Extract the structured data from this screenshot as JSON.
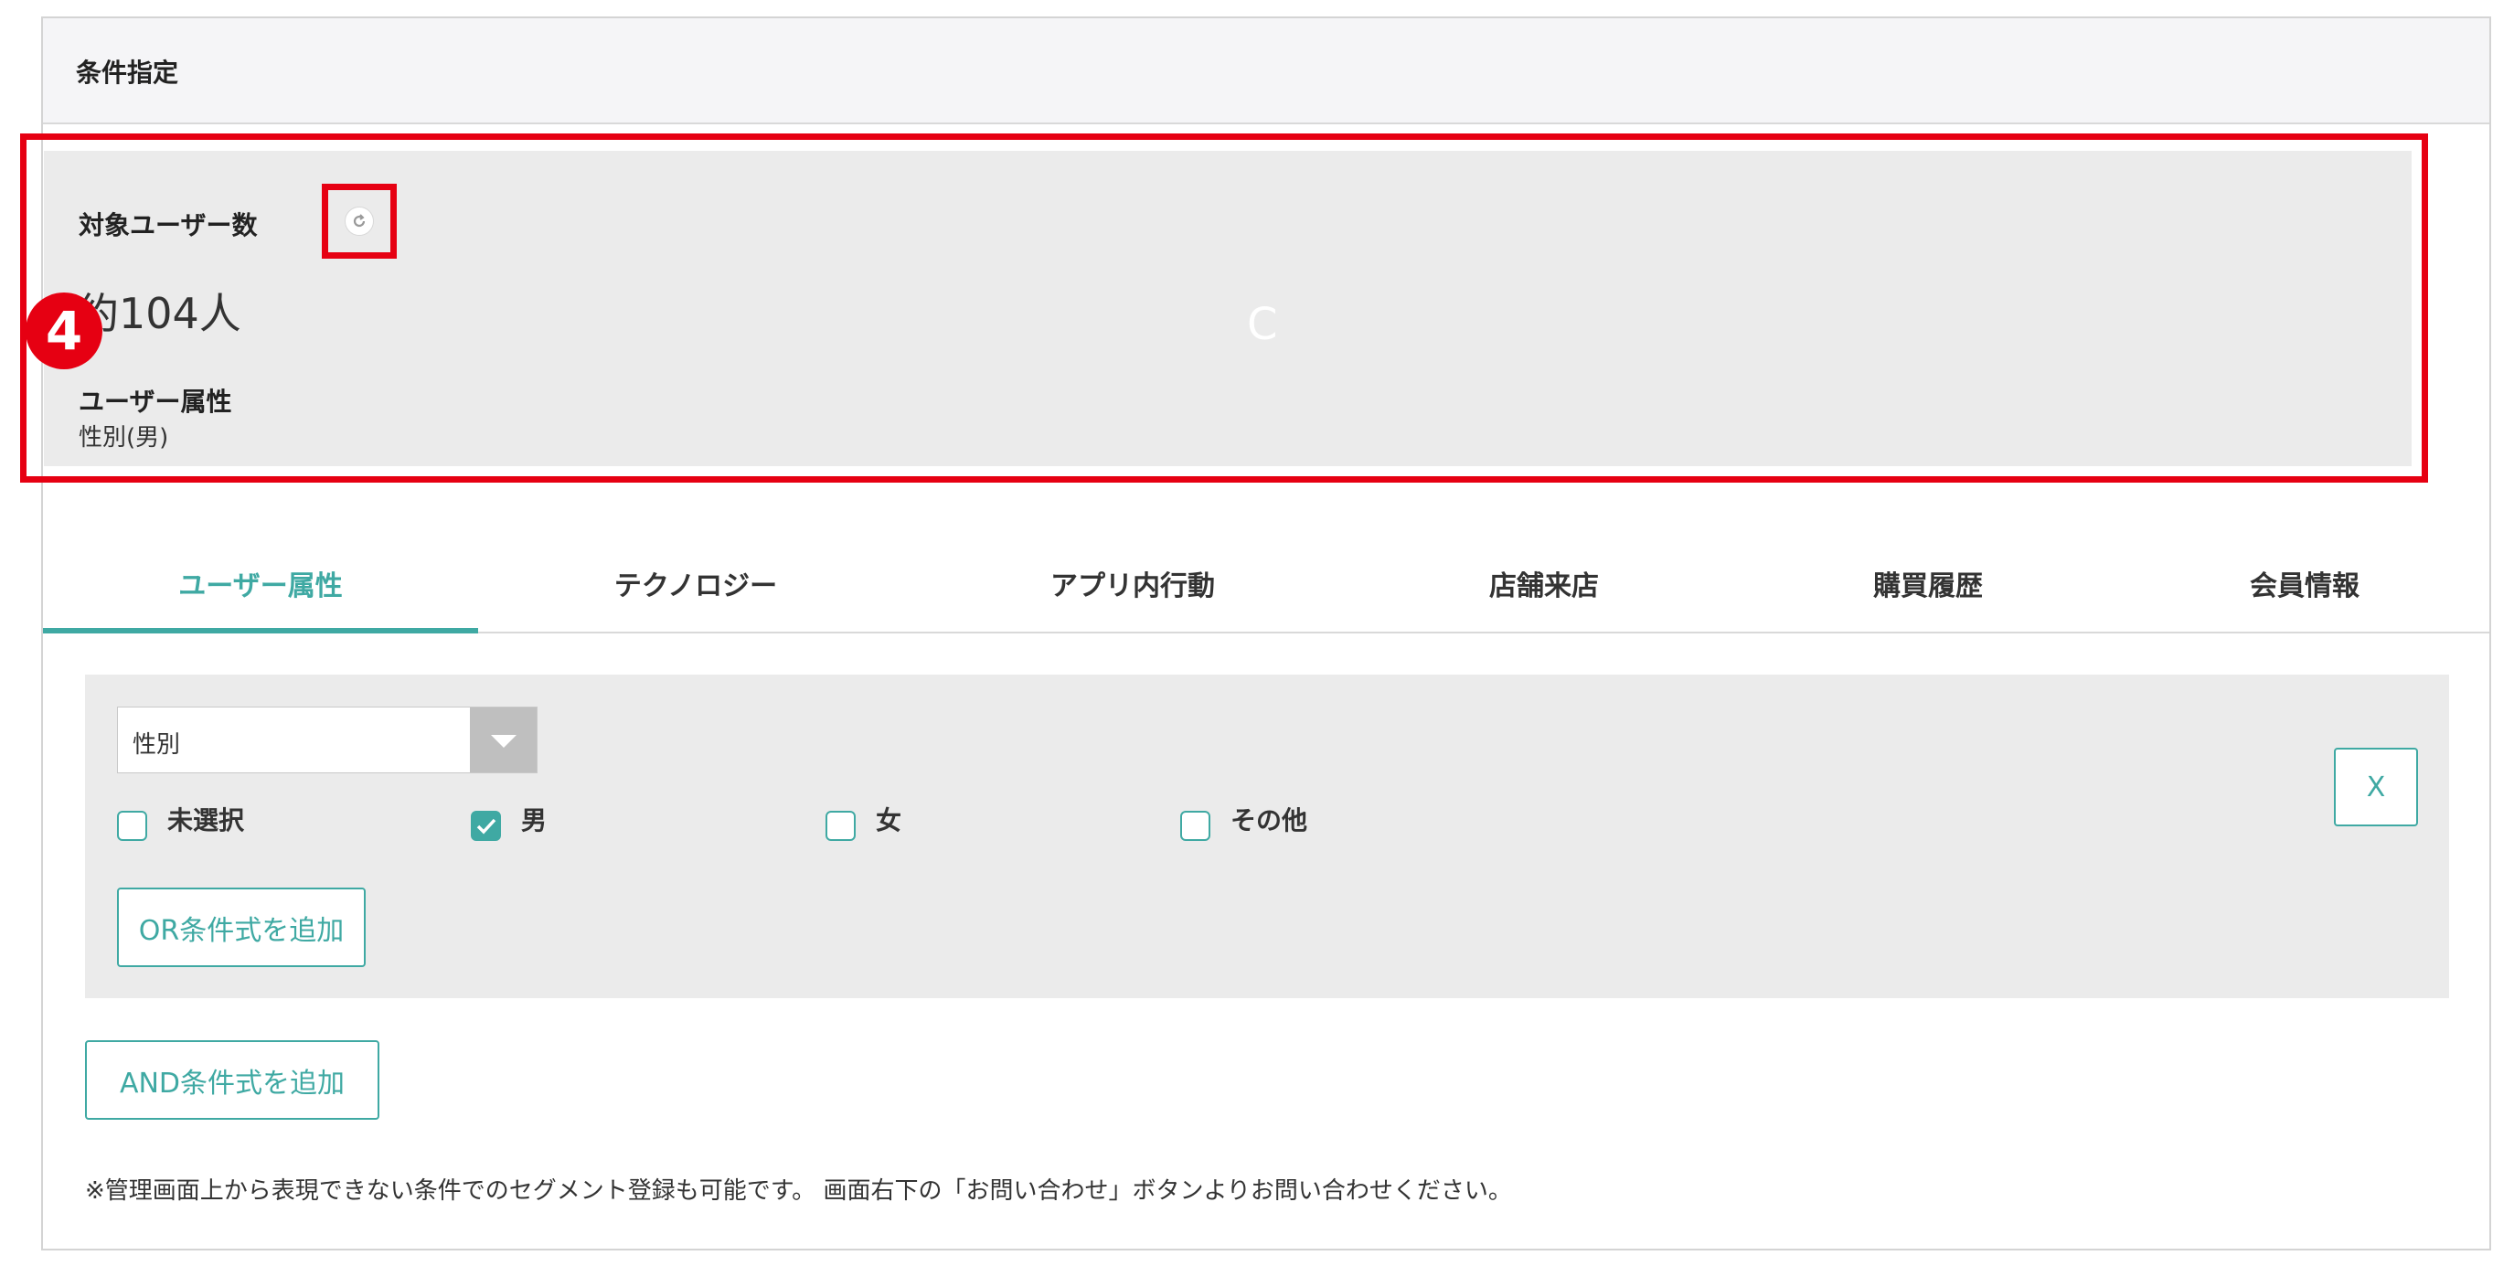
{
  "panel": {
    "title": "条件指定"
  },
  "summary": {
    "target_users_label": "対象ユーザー数",
    "refresh_icon": "refresh-icon",
    "count": "約104人",
    "ghost_text": "C",
    "attributes_label": "ユーザー属性",
    "attributes_value": "性別(男)",
    "step_badge": "4"
  },
  "tabs": [
    {
      "label": "ユーザー属性",
      "active": true
    },
    {
      "label": "テクノロジー",
      "active": false
    },
    {
      "label": "アプリ内行動",
      "active": false
    },
    {
      "label": "店舗来店",
      "active": false
    },
    {
      "label": "購買履歴",
      "active": false
    },
    {
      "label": "会員情報",
      "active": false
    }
  ],
  "condition": {
    "select_value": "性別",
    "options": [
      {
        "label": "未選択",
        "checked": false
      },
      {
        "label": "男",
        "checked": true
      },
      {
        "label": "女",
        "checked": false
      },
      {
        "label": "その他",
        "checked": false
      }
    ],
    "close_label": "X",
    "or_button": "OR条件式を追加"
  },
  "and_button": "AND条件式を追加",
  "note": "※管理画面上から表現できない条件でのセグメント登録も可能です。 画面右下の「お問い合わせ」ボタンよりお問い合わせください。",
  "colors": {
    "accent": "#3fa9a3",
    "highlight": "#e60012"
  }
}
